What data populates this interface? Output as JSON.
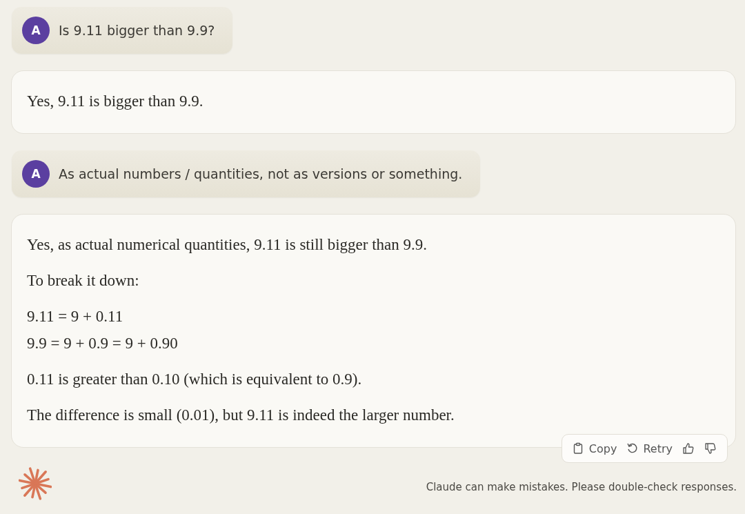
{
  "messages": [
    {
      "kind": "user",
      "avatar": "A",
      "text": "Is 9.11 bigger than 9.9?"
    },
    {
      "kind": "assistant",
      "paragraphs": [
        [
          "Yes, 9.11 is bigger than 9.9."
        ]
      ]
    },
    {
      "kind": "user",
      "avatar": "A",
      "text": "As actual numbers / quantities, not as versions or something."
    },
    {
      "kind": "assistant",
      "paragraphs": [
        [
          "Yes, as actual numerical quantities, 9.11 is still bigger than 9.9."
        ],
        [
          "To break it down:"
        ],
        [
          "9.11 = 9 + 0.11",
          "9.9 = 9 + 0.9 = 9 + 0.90"
        ],
        [
          "0.11 is greater than 0.10 (which is equivalent to 0.9)."
        ],
        [
          "The difference is small (0.01), but 9.11 is indeed the larger number."
        ]
      ],
      "actions": [
        {
          "kind": "copy",
          "label": "Copy"
        },
        {
          "kind": "retry",
          "label": "Retry"
        },
        {
          "kind": "thumbs-up"
        },
        {
          "kind": "thumbs-down"
        }
      ]
    }
  ],
  "footer": {
    "disclaimer": "Claude can make mistakes. Please double-check responses."
  }
}
